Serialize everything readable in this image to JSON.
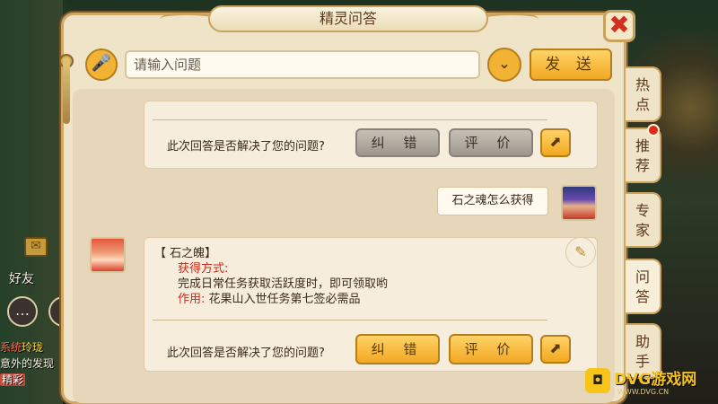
{
  "dialog": {
    "title": "精灵问答",
    "close_glyph": "✖"
  },
  "input": {
    "placeholder": "请输入问题",
    "mic_icon": "🎤",
    "dropdown_glyph": "⌄",
    "send_label": "发 送"
  },
  "side_tabs": [
    {
      "label": "热\n点"
    },
    {
      "label": "推\n荐",
      "badge": true
    },
    {
      "label": "专\n家"
    },
    {
      "label": "问\n答",
      "active": true
    },
    {
      "label": "助\n手"
    }
  ],
  "feedback": {
    "question": "此次回答是否解决了您的问题?",
    "correct_label": "纠 错",
    "rate_label": "评 价"
  },
  "chat": {
    "user_question": "石之魂怎么获得",
    "answer": {
      "title": "【 石之魄】",
      "method_label": "获得方式:",
      "method_text": "完成日常任务获取活跃度时，即可领取哟",
      "use_label": "作用:",
      "use_text": "花果山入世任务第七签必需品"
    }
  },
  "background": {
    "friend_label": "好友",
    "log_line1_sys": "系统",
    "log_line1_name": "玲珑",
    "log_line2": "意外的发现",
    "log_line3": "精彩"
  },
  "watermark": {
    "text": "DVG游戏网",
    "sub": "WWW.DVG.CN"
  },
  "colors": {
    "accent_gold": "#f2a822",
    "panel": "#efe3c8",
    "label_red": "#c42a1c",
    "badge_red": "#e0291a"
  }
}
